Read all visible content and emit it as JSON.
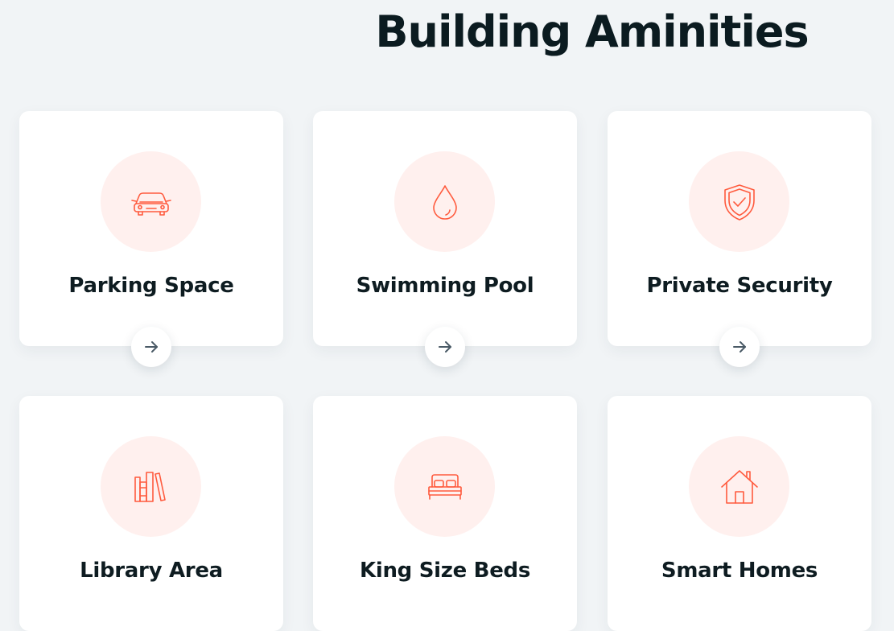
{
  "page": {
    "title": "Building Aminities"
  },
  "theme": {
    "accent": "#ff5b3e",
    "icon_bg": "#fff0ee",
    "page_bg": "#f1f4f6",
    "card_bg": "#ffffff",
    "text": "#0e1c21"
  },
  "amenities": [
    {
      "title": "Parking Space",
      "icon": "car-icon"
    },
    {
      "title": "Swimming Pool",
      "icon": "water-drop-icon"
    },
    {
      "title": "Private Security",
      "icon": "shield-check-icon"
    },
    {
      "title": "Library Area",
      "icon": "books-icon"
    },
    {
      "title": "King Size Beds",
      "icon": "bed-icon"
    },
    {
      "title": "Smart Homes",
      "icon": "house-icon"
    }
  ]
}
